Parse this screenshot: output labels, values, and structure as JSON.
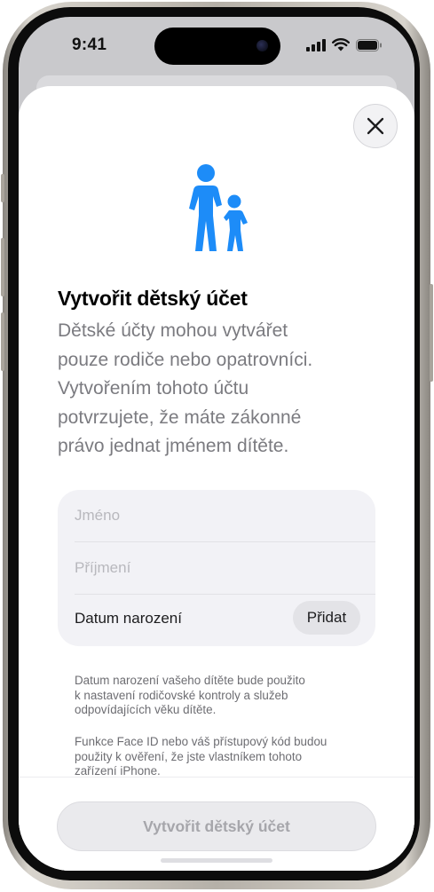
{
  "status_bar": {
    "time": "9:41"
  },
  "icons": {
    "hero": "family-icon",
    "close": "close-icon",
    "signal": "cellular-signal-icon",
    "wifi": "wifi-icon",
    "battery": "battery-icon"
  },
  "colors": {
    "accent": "#1d8cf8",
    "title": "#000000",
    "secondary_text": "#7b7b80",
    "placeholder": "#b8b8bd",
    "disabled_button_bg": "#eaeaed",
    "disabled_button_text": "#a6a6ab"
  },
  "sheet": {
    "title": "Vytvořit dětský účet",
    "description_lines": [
      "Dětské účty mohou vytvářet",
      "pouze rodiče nebo opatrovníci.",
      "Vytvořením tohoto účtu",
      "potvrzujete, že máte zákonné",
      "právo jednat jménem dítěte."
    ],
    "form": {
      "first_name": {
        "placeholder": "Jméno",
        "value": ""
      },
      "last_name": {
        "placeholder": "Příjmení",
        "value": ""
      },
      "birth_date_label": "Datum narození",
      "birth_date_action": "Přidat"
    },
    "footnote_1_lines": [
      "Datum narození vašeho dítěte bude použito",
      "k nastavení rodičovské kontroly a služeb",
      "odpovídajících věku dítěte."
    ],
    "footnote_2_lines": [
      "Funkce Face ID nebo váš přístupový kód budou",
      "použity k ověření, že jste vlastníkem tohoto",
      "zařízení iPhone."
    ],
    "primary_button": {
      "label": "Vytvořit dětský účet",
      "enabled": false
    }
  }
}
